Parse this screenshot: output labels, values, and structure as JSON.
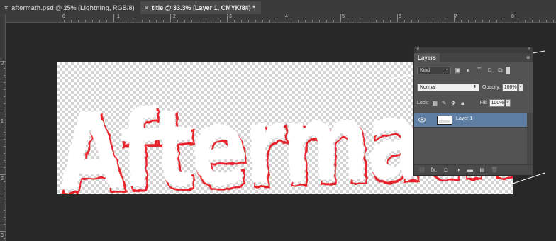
{
  "tabs": [
    {
      "label": "aftermath.psd @ 25% (Lightning, RGB/8)",
      "close": "×",
      "active": false
    },
    {
      "label": "title @ 33.3% (Layer 1, CMYK/8#) *",
      "close": "×",
      "active": true
    }
  ],
  "rulers": {
    "top": [
      "0",
      "1",
      "2",
      "3",
      "4",
      "5",
      "6",
      "7",
      "8"
    ],
    "left": [
      "0",
      "1",
      "2",
      "3"
    ]
  },
  "layers_panel": {
    "title": "Layers",
    "close": "×",
    "collapse": "»",
    "filter_kind": "Kind",
    "blend_mode": "Normal",
    "opacity_label": "Opacity:",
    "opacity_value": "100%",
    "lock_label": "Lock:",
    "fill_label": "Fill:",
    "fill_value": "100%",
    "layers": [
      {
        "name": "Layer 1",
        "selected": true,
        "visible": true
      }
    ],
    "bottom_icons": [
      "link-icon",
      "fx-icon",
      "mask-icon",
      "adjustment-icon",
      "folder-icon",
      "new-layer-icon",
      "trash-icon"
    ],
    "fx_label": "fx."
  },
  "colors": {
    "app_background": "#282828",
    "canvas_checker": "#d4d4d4",
    "text_fill": "#ffffff",
    "text_edge": "#e8212b",
    "selected_layer": "#5e7fa3"
  }
}
